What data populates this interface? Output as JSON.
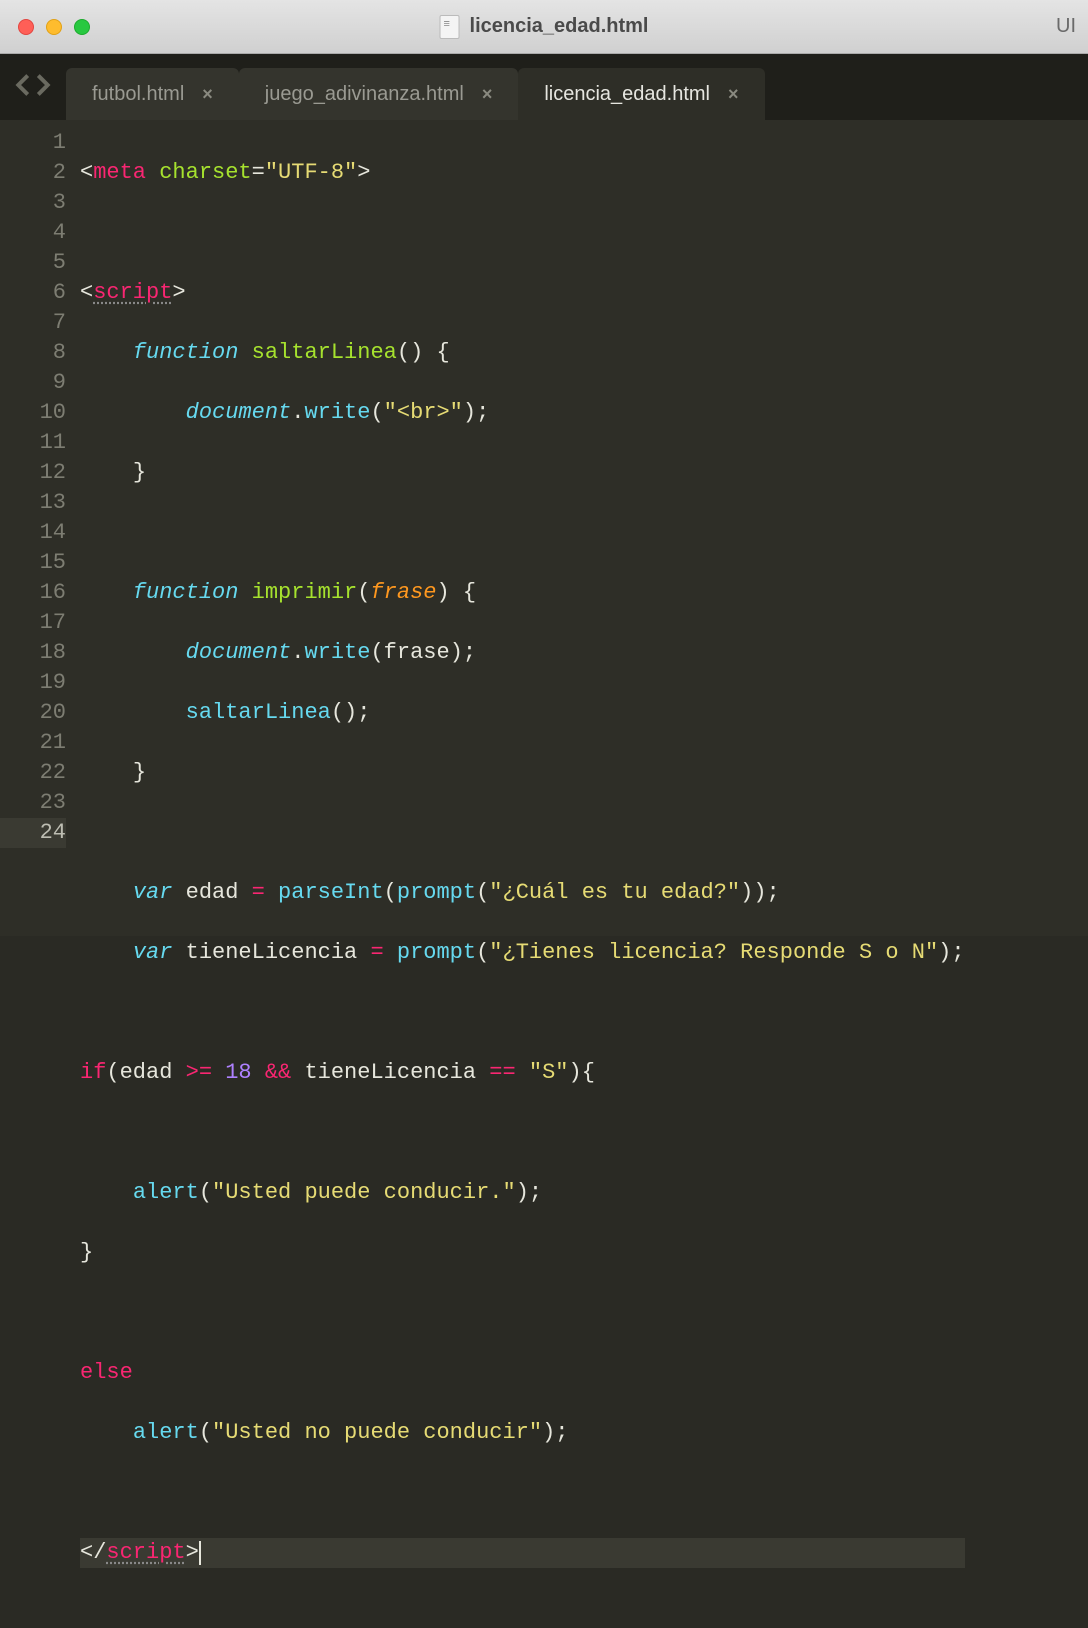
{
  "window": {
    "title": "licencia_edad.html",
    "right_truncated": "UI"
  },
  "tabs": {
    "items": [
      {
        "label": "futbol.html",
        "active": false
      },
      {
        "label": "juego_adivinanza.html",
        "active": false
      },
      {
        "label": "licencia_edad.html",
        "active": true
      }
    ]
  },
  "editor": {
    "line_count": 24,
    "current_line": 24,
    "code": {
      "l1": {
        "open": "<",
        "tag": "meta",
        "sp": " ",
        "attr": "charset",
        "eq": "=",
        "str": "\"UTF-8\"",
        "close": ">"
      },
      "l3": {
        "open": "<",
        "tag": "script",
        "close": ">"
      },
      "l4": {
        "kw": "function",
        "name": "saltarLinea",
        "paren": "() {"
      },
      "l5": {
        "obj": "document",
        "dot": ".",
        "call": "write",
        "p1": "(",
        "str": "\"<br>\"",
        "p2": ");"
      },
      "l6": {
        "brace": "}"
      },
      "l8": {
        "kw": "function",
        "name": "imprimir",
        "p1": "(",
        "param": "frase",
        "p2": ") {"
      },
      "l9": {
        "obj": "document",
        "dot": ".",
        "call": "write",
        "p1": "(",
        "arg": "frase",
        "p2": ");"
      },
      "l10": {
        "call": "saltarLinea",
        "p": "();"
      },
      "l11": {
        "brace": "}"
      },
      "l13": {
        "kw": "var",
        "id": "edad",
        "eq": " = ",
        "fn1": "parseInt",
        "p1": "(",
        "fn2": "prompt",
        "p2": "(",
        "str": "\"¿Cuál es tu edad?\"",
        "p3": "));"
      },
      "l14": {
        "kw": "var",
        "id": "tieneLicencia",
        "eq": " = ",
        "fn": "prompt",
        "p1": "(",
        "str": "\"¿Tienes licencia? Responde S o N\"",
        "p2": ");"
      },
      "l16": {
        "kw": "if",
        "p1": "(",
        "id1": "edad ",
        "op1": ">=",
        "sp1": " ",
        "num": "18",
        "sp2": " ",
        "op2": "&&",
        "sp3": " ",
        "id2": "tieneLicencia ",
        "op3": "==",
        "sp4": " ",
        "str": "\"S\"",
        "p2": "){"
      },
      "l18": {
        "fn": "alert",
        "p1": "(",
        "str": "\"Usted puede conducir.\"",
        "p2": ");"
      },
      "l19": {
        "brace": "}"
      },
      "l21": {
        "kw": "else"
      },
      "l22": {
        "fn": "alert",
        "p1": "(",
        "str": "\"Usted no puede conducir\"",
        "p2": ");"
      },
      "l24": {
        "open": "</",
        "tag": "script",
        "close": ">"
      }
    }
  }
}
